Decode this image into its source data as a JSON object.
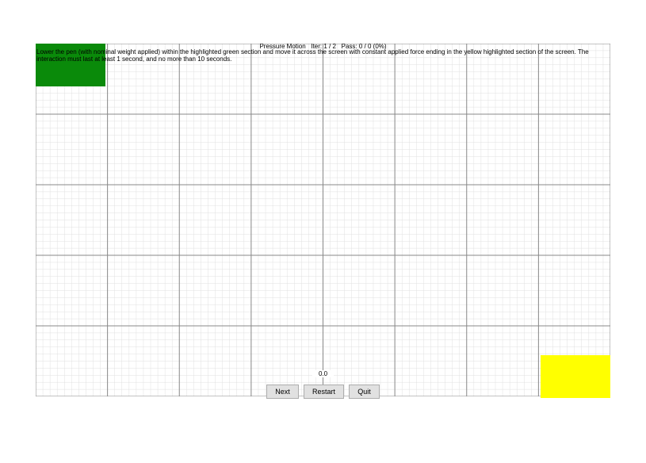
{
  "header": {
    "title_prefix": "Pressure Motion",
    "iter_label": "Iter:",
    "iter_value": "1 / 2",
    "pass_label": "Pass:",
    "pass_value": "0 / 0 (0%)"
  },
  "instructions": "Lower the pen (with nominal weight applied) within the highlighted green section and move it across the screen with constant applied force ending in the yellow highlighted section of the screen. The interaction must last at least 1 second, and no more than 10 seconds.",
  "value_display": "0.0",
  "buttons": {
    "next": "Next",
    "restart": "Restart",
    "quit": "Quit"
  },
  "zones": {
    "start": {
      "color": "#0a8a0a",
      "name": "green-start-zone"
    },
    "end": {
      "color": "#ffff00",
      "name": "yellow-end-zone"
    }
  },
  "grid": {
    "major_cols": 8,
    "major_rows": 5,
    "minor_per_major": 10
  }
}
